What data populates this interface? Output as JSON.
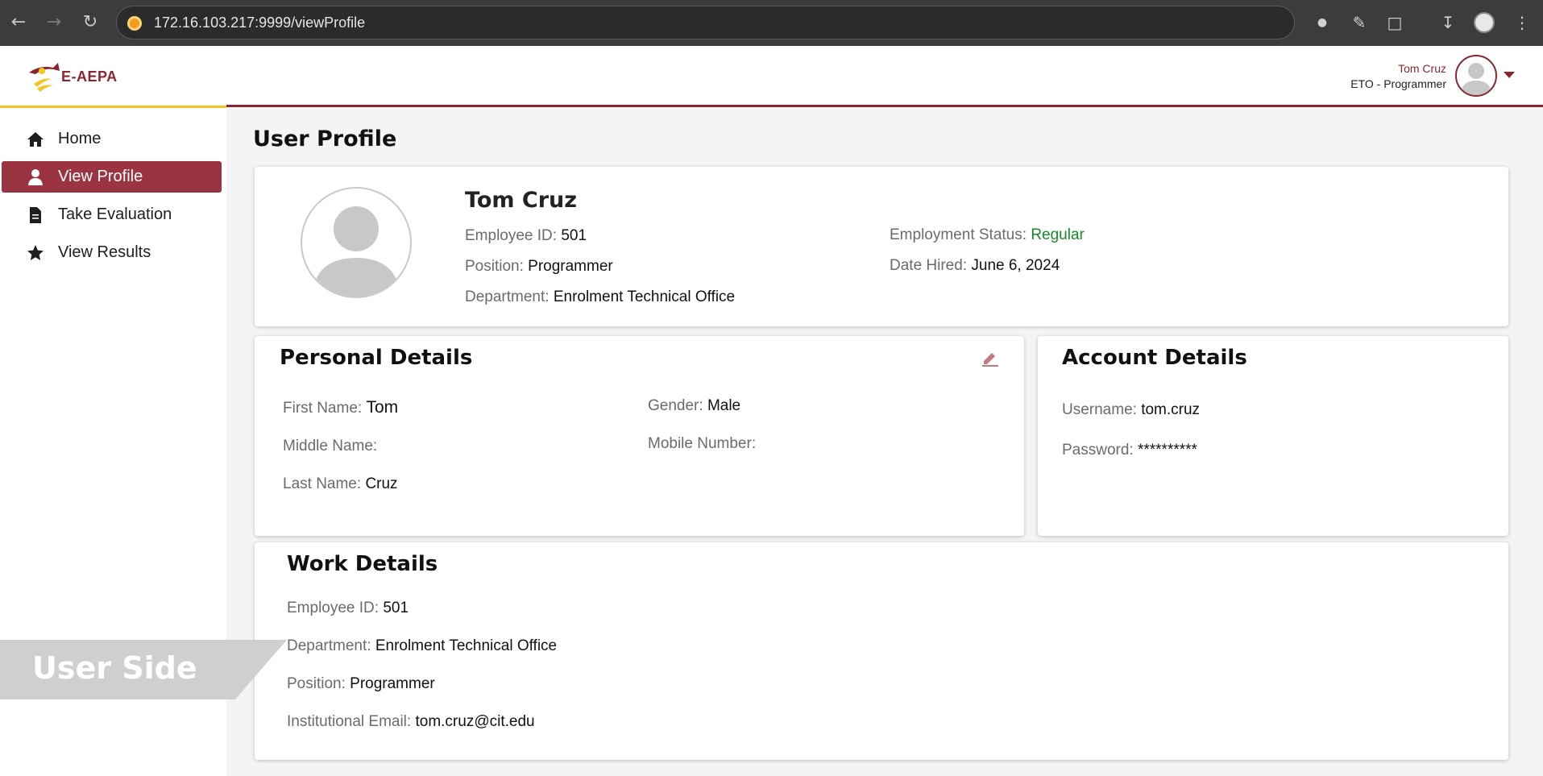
{
  "browser": {
    "url": "172.16.103.217:9999/viewProfile"
  },
  "app": {
    "logo_text": "E-AEPA",
    "user_name": "Tom Cruz",
    "user_role": "ETO - Programmer",
    "accent_color": "#8a2430",
    "highlight_color": "#f3c623"
  },
  "sidebar": {
    "items": [
      {
        "label": "Home",
        "icon": "home-icon",
        "active": false
      },
      {
        "label": "View Profile",
        "icon": "user-icon",
        "active": true
      },
      {
        "label": "Take Evaluation",
        "icon": "document-icon",
        "active": false
      },
      {
        "label": "View Results",
        "icon": "star-icon",
        "active": false
      }
    ]
  },
  "watermark": "User Side",
  "page": {
    "title": "User Profile"
  },
  "profile": {
    "name": "Tom Cruz",
    "employee_id_label": "Employee ID:",
    "employee_id": "501",
    "position_label": "Position:",
    "position": "Programmer",
    "department_label": "Department:",
    "department": "Enrolment Technical Office",
    "employment_status_label": "Employment Status:",
    "employment_status": "Regular",
    "date_hired_label": "Date Hired:",
    "date_hired": "June 6, 2024"
  },
  "personal": {
    "title": "Personal Details",
    "first_name_label": "First Name:",
    "first_name": "Tom",
    "middle_name_label": "Middle Name:",
    "middle_name": "",
    "last_name_label": "Last Name:",
    "last_name": "Cruz",
    "gender_label": "Gender:",
    "gender": "Male",
    "mobile_label": "Mobile Number:",
    "mobile": ""
  },
  "account": {
    "title": "Account Details",
    "username_label": "Username:",
    "username": "tom.cruz",
    "password_label": "Password:",
    "password": "**********"
  },
  "work": {
    "title": "Work Details",
    "employee_id_label": "Employee ID:",
    "employee_id": "501",
    "department_label": "Department:",
    "department": "Enrolment Technical Office",
    "position_label": "Position:",
    "position": "Programmer",
    "email_label": "Institutional Email:",
    "email": "tom.cruz@cit.edu"
  }
}
